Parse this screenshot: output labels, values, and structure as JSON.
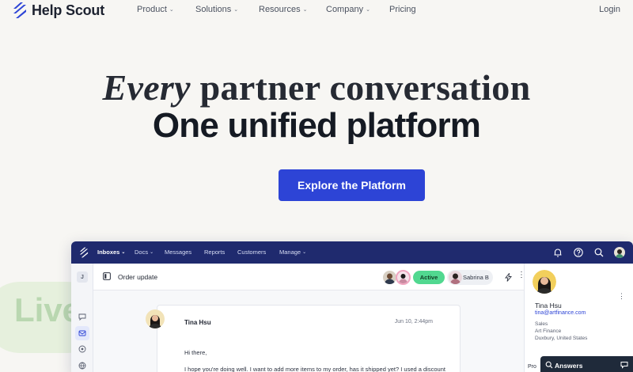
{
  "brand": {
    "name": "Help Scout",
    "logo_icon": "help-scout-logo-icon",
    "accent": "#2d44d6"
  },
  "nav": {
    "items": [
      {
        "label": "Product",
        "dropdown": true
      },
      {
        "label": "Solutions",
        "dropdown": true
      },
      {
        "label": "Resources",
        "dropdown": true
      },
      {
        "label": "Company",
        "dropdown": true
      },
      {
        "label": "Pricing",
        "dropdown": false
      }
    ],
    "login": "Login"
  },
  "hero": {
    "line1_italic": "Every",
    "line1_rest": " partner conversation",
    "line2": "One unified platform",
    "cta": "Explore the Platform"
  },
  "decor": {
    "live": "Live"
  },
  "app": {
    "nav": [
      {
        "label": "Inboxes",
        "dropdown": true,
        "active": true
      },
      {
        "label": "Docs",
        "dropdown": true,
        "active": false
      },
      {
        "label": "Messages",
        "dropdown": false,
        "active": false
      },
      {
        "label": "Reports",
        "dropdown": false,
        "active": false
      },
      {
        "label": "Customers",
        "dropdown": false,
        "active": false
      },
      {
        "label": "Manage",
        "dropdown": true,
        "active": false
      }
    ],
    "rail_initial": "J",
    "conversation": {
      "title": "Order update",
      "status": "Active",
      "assignee": "Sabrina B"
    },
    "message": {
      "from": "Tina Hsu",
      "date": "Jun 10, 2:44pm",
      "greeting": "Hi there,",
      "body": "I hope you're doing well. I want to add more items to my order, has it shipped yet? I used a discount"
    },
    "customer": {
      "name": "Tina Hsu",
      "email": "tina@artfinance.com",
      "role": "Sales",
      "company": "Art Finance",
      "location": "Duxbury, United States"
    }
  },
  "widget": {
    "label": "Answers",
    "prod_fragment": "Pro"
  }
}
